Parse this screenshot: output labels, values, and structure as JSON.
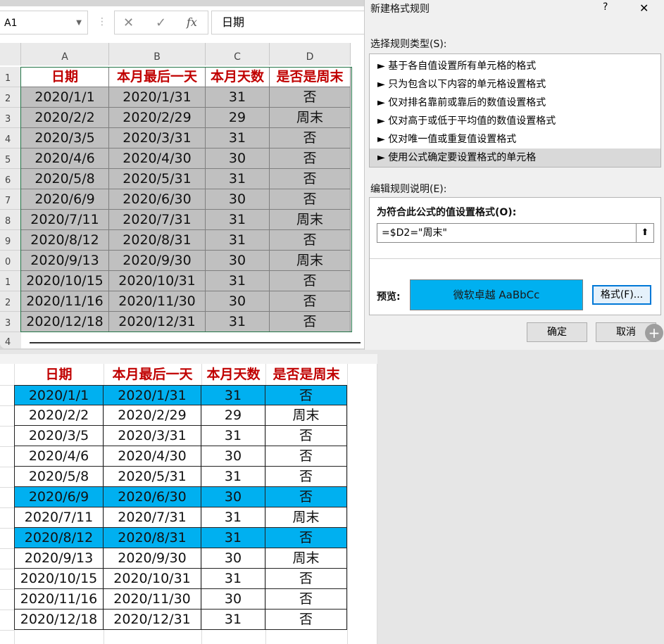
{
  "name_box": "A1",
  "formula_bar": {
    "cancel_icon": "✕",
    "enter_icon": "✓",
    "fx_icon": "fx",
    "value": "日期"
  },
  "columns": [
    "A",
    "B",
    "C",
    "D"
  ],
  "row_numbers": [
    "1",
    "2",
    "3",
    "4",
    "5",
    "6",
    "7",
    "8",
    "9",
    "0",
    "1",
    "2",
    "3",
    "4"
  ],
  "headers": [
    "日期",
    "本月最后一天",
    "本月天数",
    "是否是周末"
  ],
  "rows": [
    [
      "2020/1/1",
      "2020/1/31",
      "31",
      "否"
    ],
    [
      "2020/2/2",
      "2020/2/29",
      "29",
      "周末"
    ],
    [
      "2020/3/5",
      "2020/3/31",
      "31",
      "否"
    ],
    [
      "2020/4/6",
      "2020/4/30",
      "30",
      "否"
    ],
    [
      "2020/5/8",
      "2020/5/31",
      "31",
      "否"
    ],
    [
      "2020/6/9",
      "2020/6/30",
      "30",
      "否"
    ],
    [
      "2020/7/11",
      "2020/7/31",
      "31",
      "周末"
    ],
    [
      "2020/8/12",
      "2020/8/31",
      "31",
      "否"
    ],
    [
      "2020/9/13",
      "2020/9/30",
      "30",
      "周末"
    ],
    [
      "2020/10/15",
      "2020/10/31",
      "31",
      "否"
    ],
    [
      "2020/11/16",
      "2020/11/30",
      "30",
      "否"
    ],
    [
      "2020/12/18",
      "2020/12/31",
      "31",
      "否"
    ]
  ],
  "highlighted_rows": [
    0,
    5,
    7
  ],
  "dialog": {
    "title": "新建格式规则",
    "help": "?",
    "close": "✕",
    "rule_type_label": "选择规则类型(S):",
    "rule_types": [
      "► 基于各自值设置所有单元格的格式",
      "► 只为包含以下内容的单元格设置格式",
      "► 仅对排名靠前或靠后的数值设置格式",
      "► 仅对高于或低于平均值的数值设置格式",
      "► 仅对唯一值或重复值设置格式",
      "► 使用公式确定要设置格式的单元格"
    ],
    "edit_label": "编辑规则说明(E):",
    "formula_label": "为符合此公式的值设置格式(O):",
    "formula_value": "=$D2=\"周末\"",
    "preview_label": "预览:",
    "preview_text": "微软卓越  AaBbCc",
    "format_button": "格式(F)...",
    "ok_button": "确定",
    "cancel_button": "取消"
  },
  "colors": {
    "preview_fill": "#00b0f0",
    "header_text": "#c00000",
    "selection": "#c0c0c0"
  }
}
